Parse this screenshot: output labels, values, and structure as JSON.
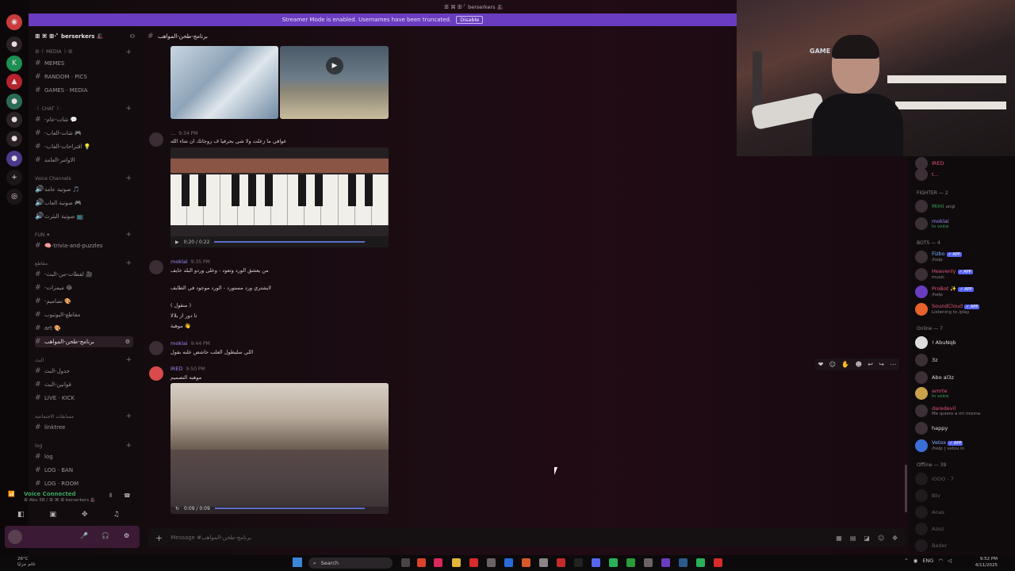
{
  "banner": {
    "text": "Streamer Mode is enabled. Usernames have been truncated.",
    "button": "Disable"
  },
  "window": {
    "title": "ꕥ ⌘ ꕥ·ﾟ berserkers 🎩"
  },
  "guild": {
    "name": "ꕥ ⌘ ꕥ·ﾟ berserkers 🎩"
  },
  "channels": {
    "media_cat": "ꕥ·꒰ MEDIA ꒱·ꕥ",
    "memes": "MEMES",
    "random": "RANDOM · PICS",
    "games": "GAMES · MEDIA",
    "chat_cat": "·꒰ CHAT ꒱·",
    "ch1": "-شات-عام 💬",
    "ch2": "-شات-العاب 🎮",
    "ch3": "-اقتراحات-العاب 💡",
    "ch4": "الاوامر-العامة",
    "voice_cat": "Voice Channels",
    "v1": "صوتية عامة 🎵",
    "v2": "صوتية العاب 🎮",
    "v3": "صوتية البثرث 📺",
    "fun_cat": "FUN ✦",
    "trivia": "🧠-trivia-and-puzzles",
    "clips_cat": "مقاطع",
    "c1": "-لقطات-من-البث 🎥",
    "c2": "-ميمزات 😂",
    "c3": "-تصاميم 🎨",
    "c4": "مقاطع-اليوتيوب",
    "c5": "art 🎨",
    "c6": "برنامج-طحن-المواهب",
    "stream_cat": "البث",
    "s1": "جدول-البث",
    "s2": "قوانين-البث",
    "s3": "LIVE · KICK",
    "contest_cat": "مسابقات الاجتماعية",
    "linktree": "linktree",
    "log_cat": "log",
    "log": "log",
    "logban": "LOG · BAN",
    "logroom": "LOG · ROOM"
  },
  "voice": {
    "status": "Voice Connected",
    "channel": "ꕥ Abu 5B / ꕥ ⌘ ꕥ berserkers 🎩"
  },
  "topbar": {
    "channel": "برنامج-طحن-المواهب"
  },
  "messages": [
    {
      "user": "...",
      "time": "9:34 PM",
      "text": "عوافي ما زعلت ولا شي بحرفيا ف زوجاتك ان شاء الله"
    },
    {
      "user": "moklai",
      "time": "9:35 PM",
      "line1": "من يعشق الورد وتعود - وعلى وردو البلد خايف",
      "line2": "لايشتري ورد مستورد - الورد موجود في الطايف",
      "line3": "( منقول )",
      "line4": "تا دور از بلالا",
      "line5": "👋 موهبة"
    },
    {
      "user": "moklai",
      "time": "9:44 PM",
      "text": "اللي سليطول العلب حاشص علبه بقول"
    },
    {
      "user": "IRED",
      "time": "9:50 PM",
      "text": "موهبه التصميم"
    }
  ],
  "media": {
    "audio_time": "0:20 / 0:22",
    "video_time": "0:09 / 0:09"
  },
  "input": {
    "placeholder": "Message #برنامج-طحن-المواهب"
  },
  "members": {
    "fighter_header": "FIGHTER — 2",
    "fighters": [
      {
        "name": "Mimi",
        "sub": "",
        "tag": "angl"
      },
      {
        "name": "moklai",
        "sub": "In voice"
      }
    ],
    "bots_header": "BOTS — 4",
    "bots": [
      {
        "name": "Fizbo",
        "sub": "/help"
      },
      {
        "name": "Heavenly",
        "sub": "music"
      },
      {
        "name": "ProBot ✨",
        "sub": "/help"
      },
      {
        "name": "SoundCloud",
        "sub": "Listening to /play"
      }
    ],
    "online_header": "Online — 7",
    "online": [
      {
        "name": "! AbuNqb",
        "sub": ""
      },
      {
        "name": "3z",
        "sub": ""
      },
      {
        "name": "Abo al3z",
        "sub": ""
      },
      {
        "name": "amrte",
        "sub": "In voice"
      },
      {
        "name": "daredevil",
        "sub": "Me quiero a mi misma"
      },
      {
        "name": "happy",
        "sub": ""
      },
      {
        "name": "Vetox",
        "sub": "/help | vetox.in"
      }
    ],
    "offline_header": "Offline — 39",
    "offline": [
      "IOOO - 7",
      "Btv",
      "Anas",
      "Azoz",
      "Bader"
    ],
    "top_names": [
      "IRED",
      "t..."
    ],
    "app_label": "✓ APP"
  },
  "webcam": {
    "logo": "GAME OVER"
  },
  "taskbar": {
    "weather_temp": "26°C",
    "weather_desc": "غائم جزئيًا",
    "search": "Search",
    "lang": "ENG",
    "time": "9:52 PM",
    "date": "4/11/2025"
  },
  "colors": {
    "accent": "#6a3cbf",
    "username": "#9b8cf0",
    "online": "#3ba55d"
  }
}
